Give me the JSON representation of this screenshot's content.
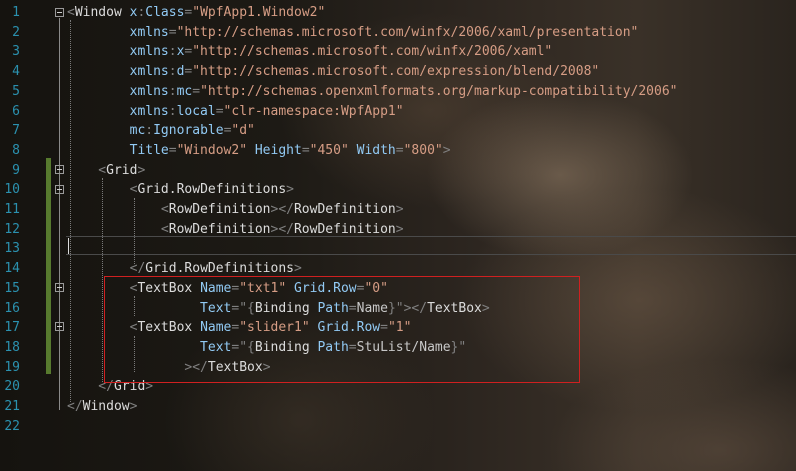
{
  "line_numbers": [
    "1",
    "2",
    "3",
    "4",
    "5",
    "6",
    "7",
    "8",
    "9",
    "10",
    "11",
    "12",
    "13",
    "14",
    "15",
    "16",
    "17",
    "18",
    "19",
    "20",
    "21",
    "22"
  ],
  "lines": [
    [
      {
        "c": "b",
        "t": "<"
      },
      {
        "c": "e",
        "t": "Window"
      },
      {
        "c": "a",
        "t": " x"
      },
      {
        "c": "b",
        "t": ":"
      },
      {
        "c": "a",
        "t": "Class"
      },
      {
        "c": "b",
        "t": "="
      },
      {
        "c": "s",
        "t": "\"WpfApp1.Window2\""
      }
    ],
    [
      {
        "c": "a",
        "t": "        xmlns"
      },
      {
        "c": "b",
        "t": "="
      },
      {
        "c": "s",
        "t": "\"http://schemas.microsoft.com/winfx/2006/xaml/presentation\""
      }
    ],
    [
      {
        "c": "a",
        "t": "        xmlns"
      },
      {
        "c": "b",
        "t": ":"
      },
      {
        "c": "a",
        "t": "x"
      },
      {
        "c": "b",
        "t": "="
      },
      {
        "c": "s",
        "t": "\"http://schemas.microsoft.com/winfx/2006/xaml\""
      }
    ],
    [
      {
        "c": "a",
        "t": "        xmlns"
      },
      {
        "c": "b",
        "t": ":"
      },
      {
        "c": "a",
        "t": "d"
      },
      {
        "c": "b",
        "t": "="
      },
      {
        "c": "s",
        "t": "\"http://schemas.microsoft.com/expression/blend/2008\""
      }
    ],
    [
      {
        "c": "a",
        "t": "        xmlns"
      },
      {
        "c": "b",
        "t": ":"
      },
      {
        "c": "a",
        "t": "mc"
      },
      {
        "c": "b",
        "t": "="
      },
      {
        "c": "s",
        "t": "\"http://schemas.openxmlformats.org/markup-compatibility/2006\""
      }
    ],
    [
      {
        "c": "a",
        "t": "        xmlns"
      },
      {
        "c": "b",
        "t": ":"
      },
      {
        "c": "a",
        "t": "local"
      },
      {
        "c": "b",
        "t": "="
      },
      {
        "c": "s",
        "t": "\"clr-namespace:WpfApp1\""
      }
    ],
    [
      {
        "c": "a",
        "t": "        mc"
      },
      {
        "c": "b",
        "t": ":"
      },
      {
        "c": "a",
        "t": "Ignorable"
      },
      {
        "c": "b",
        "t": "="
      },
      {
        "c": "s",
        "t": "\"d\""
      }
    ],
    [
      {
        "c": "a",
        "t": "        Title"
      },
      {
        "c": "b",
        "t": "="
      },
      {
        "c": "s",
        "t": "\"Window2\""
      },
      {
        "c": "a",
        "t": " Height"
      },
      {
        "c": "b",
        "t": "="
      },
      {
        "c": "s",
        "t": "\"450\""
      },
      {
        "c": "a",
        "t": " Width"
      },
      {
        "c": "b",
        "t": "="
      },
      {
        "c": "s",
        "t": "\"800\""
      },
      {
        "c": "b",
        "t": ">"
      }
    ],
    [
      {
        "c": "b",
        "t": "    <"
      },
      {
        "c": "e",
        "t": "Grid"
      },
      {
        "c": "b",
        "t": ">"
      }
    ],
    [
      {
        "c": "b",
        "t": "        <"
      },
      {
        "c": "e",
        "t": "Grid.RowDefinitions"
      },
      {
        "c": "b",
        "t": ">"
      }
    ],
    [
      {
        "c": "b",
        "t": "            <"
      },
      {
        "c": "e",
        "t": "RowDefinition"
      },
      {
        "c": "b",
        "t": "></"
      },
      {
        "c": "e",
        "t": "RowDefinition"
      },
      {
        "c": "b",
        "t": ">"
      }
    ],
    [
      {
        "c": "b",
        "t": "            <"
      },
      {
        "c": "e",
        "t": "RowDefinition"
      },
      {
        "c": "b",
        "t": "></"
      },
      {
        "c": "e",
        "t": "RowDefinition"
      },
      {
        "c": "b",
        "t": ">"
      }
    ],
    [],
    [
      {
        "c": "b",
        "t": "        </"
      },
      {
        "c": "e",
        "t": "Grid.RowDefinitions"
      },
      {
        "c": "b",
        "t": ">"
      }
    ],
    [
      {
        "c": "b",
        "t": "        <"
      },
      {
        "c": "e",
        "t": "TextBox"
      },
      {
        "c": "a",
        "t": " Name"
      },
      {
        "c": "b",
        "t": "="
      },
      {
        "c": "s",
        "t": "\"txt1\""
      },
      {
        "c": "a",
        "t": " Grid.Row"
      },
      {
        "c": "b",
        "t": "="
      },
      {
        "c": "s",
        "t": "\"0\""
      }
    ],
    [
      {
        "c": "a",
        "t": "                 Text"
      },
      {
        "c": "b",
        "t": "="
      },
      {
        "c": "b",
        "t": "\"{"
      },
      {
        "c": "e",
        "t": "Binding"
      },
      {
        "c": "a",
        "t": " Path"
      },
      {
        "c": "b",
        "t": "="
      },
      {
        "c": "v",
        "t": "Name"
      },
      {
        "c": "b",
        "t": "}\"></"
      },
      {
        "c": "e",
        "t": "TextBox"
      },
      {
        "c": "b",
        "t": ">"
      }
    ],
    [
      {
        "c": "b",
        "t": "        <"
      },
      {
        "c": "e",
        "t": "TextBox"
      },
      {
        "c": "a",
        "t": " Name"
      },
      {
        "c": "b",
        "t": "="
      },
      {
        "c": "s",
        "t": "\"slider1\""
      },
      {
        "c": "a",
        "t": " Grid.Row"
      },
      {
        "c": "b",
        "t": "="
      },
      {
        "c": "s",
        "t": "\"1\""
      }
    ],
    [
      {
        "c": "a",
        "t": "                 Text"
      },
      {
        "c": "b",
        "t": "="
      },
      {
        "c": "b",
        "t": "\"{"
      },
      {
        "c": "e",
        "t": "Binding"
      },
      {
        "c": "a",
        "t": " Path"
      },
      {
        "c": "b",
        "t": "="
      },
      {
        "c": "v",
        "t": "StuList/Name"
      },
      {
        "c": "b",
        "t": "}\""
      }
    ],
    [
      {
        "c": "b",
        "t": "               ></"
      },
      {
        "c": "e",
        "t": "TextBox"
      },
      {
        "c": "b",
        "t": ">"
      }
    ],
    [
      {
        "c": "b",
        "t": "    </"
      },
      {
        "c": "e",
        "t": "Grid"
      },
      {
        "c": "b",
        "t": ">"
      }
    ],
    [
      {
        "c": "b",
        "t": "</"
      },
      {
        "c": "e",
        "t": "Window"
      },
      {
        "c": "b",
        "t": ">"
      }
    ],
    []
  ]
}
